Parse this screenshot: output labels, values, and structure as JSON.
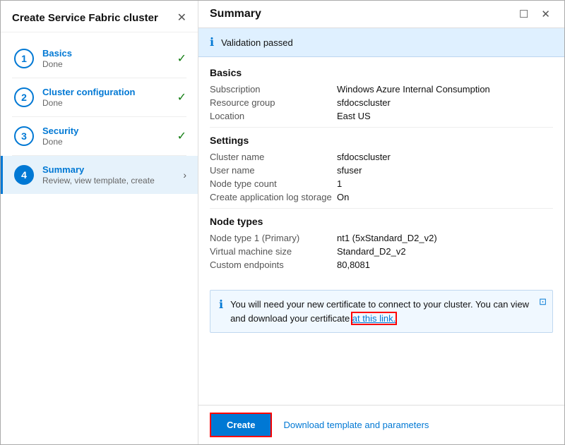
{
  "dialog": {
    "title": "Create Service Fabric cluster",
    "close_icon": "✕"
  },
  "left_panel": {
    "title": "Create Service Fabric cluster",
    "steps": [
      {
        "num": "1",
        "title": "Basics",
        "subtitle": "Done",
        "check": "✓",
        "active": false
      },
      {
        "num": "2",
        "title": "Cluster configuration",
        "subtitle": "Done",
        "check": "✓",
        "active": false
      },
      {
        "num": "3",
        "title": "Security",
        "subtitle": "Done",
        "check": "✓",
        "active": false
      },
      {
        "num": "4",
        "title": "Summary",
        "subtitle": "Review, view template, create",
        "check": "",
        "active": true
      }
    ]
  },
  "right_panel": {
    "title": "Summary",
    "window_btn": "☐",
    "close_btn": "✕",
    "validation": {
      "icon": "ℹ",
      "text": "Validation passed"
    },
    "sections": [
      {
        "title": "Basics",
        "fields": [
          {
            "label": "Subscription",
            "value": "Windows Azure Internal Consumption"
          },
          {
            "label": "Resource group",
            "value": "sfdocscluster"
          },
          {
            "label": "Location",
            "value": "East US"
          }
        ]
      },
      {
        "title": "Settings",
        "fields": [
          {
            "label": "Cluster name",
            "value": "sfdocscluster"
          },
          {
            "label": "User name",
            "value": "sfuser"
          },
          {
            "label": "Node type count",
            "value": "1"
          },
          {
            "label": "Create application log storage",
            "value": "On"
          }
        ]
      },
      {
        "title": "Node types",
        "fields": [
          {
            "label": "Node type 1 (Primary)",
            "value": "nt1 (5xStandard_D2_v2)"
          },
          {
            "label": "Virtual machine size",
            "value": "Standard_D2_v2"
          },
          {
            "label": "Custom endpoints",
            "value": "80,8081"
          }
        ]
      }
    ],
    "info_notice": {
      "icon": "ℹ",
      "text_before": "You will need your new certificate to connect to your cluster. You can view and download your certificate ",
      "link_text": "at this link.",
      "external_icon": "⊡"
    },
    "footer": {
      "create_label": "Create",
      "template_link": "Download template and parameters"
    }
  }
}
